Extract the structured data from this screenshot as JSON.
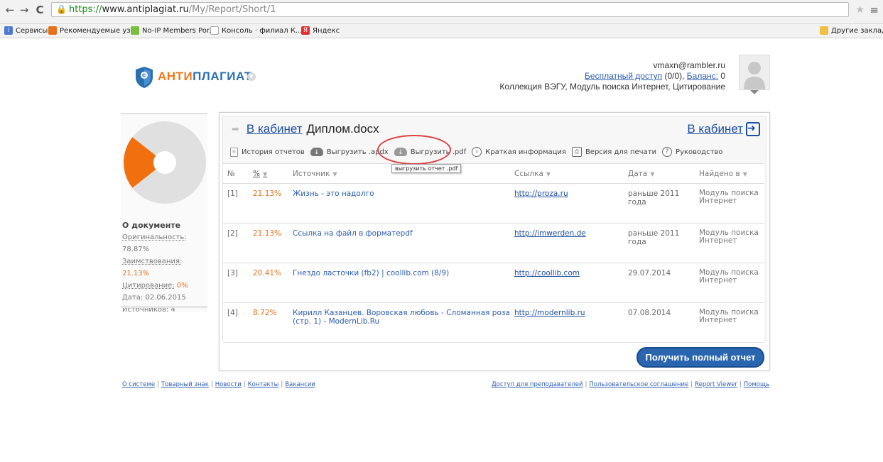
{
  "browser": {
    "url_secure": "https://",
    "url_host": "www.antiplagiat.ru",
    "url_path": "/My/Report/Short/1",
    "bookmarks": [
      {
        "label": "Сервисы",
        "icon": "apps-icon",
        "color": "#4a7bd0"
      },
      {
        "label": "Рекомендуемые уз...",
        "icon": "bookmark-icon",
        "color": "#e8701a"
      },
      {
        "label": "No-IP Members Por...",
        "icon": "bookmark-icon",
        "color": "#7cbf3a"
      },
      {
        "label": "Консоль · филиал К...",
        "icon": "page-icon",
        "color": "#aaaaaa"
      },
      {
        "label": "Яндекс",
        "icon": "yandex-icon",
        "color": "#e03030"
      }
    ],
    "other_bookmarks": "Другие закладки"
  },
  "header": {
    "logo_part1": "АНТИ",
    "logo_part2": "ПЛАГИАТ",
    "email": "vmaxn@rambler.ru",
    "access_link": "Бесплатный доступ",
    "access_count": " (0/0), ",
    "balance_link": "Баланс:",
    "balance_value": " 0",
    "collection": "Коллекция ВЭГУ, Модуль поиска Интернет, Цитирование"
  },
  "sidebar": {
    "title": "О документе",
    "originality_label": "Оригинальность:",
    "originality_value": "78.87%",
    "borrowing_label": "Заимствования:",
    "borrowing_value": "21.13%",
    "citation_label": "Цитирование:",
    "citation_value": "0%",
    "date_label": "Дата:",
    "date_value": "02.06.2015",
    "sources_label": "Источников:",
    "sources_value": "4",
    "pie": {
      "originality": 78.87,
      "borrowing": 21.13,
      "colors": {
        "originality": "#e0e0e0",
        "borrowing": "#f07010"
      }
    }
  },
  "panel": {
    "cabinet_link": "В кабинет",
    "doc_name": "Диплом.docx",
    "cabinet_right": "В кабинет",
    "toolbar": {
      "history": "История отчетов",
      "export_apdx": "Выгрузить .apdx",
      "export_pdf": "Выгрузить .pdf",
      "short_info": "Краткая информация",
      "print_version": "Версия для печати",
      "guide": "Руководство"
    },
    "tooltip": "выгрузить отчет .pdf",
    "columns": {
      "num": "№",
      "pct": "%",
      "source": "Источник",
      "link": "Ссылка",
      "date": "Дата",
      "found_in": "Найдено в"
    },
    "rows": [
      {
        "num": "[1]",
        "pct": "21.13%",
        "source": "Жизнь - это надолго",
        "link": "http://proza.ru",
        "date": "раньше 2011 года",
        "found": "Модуль поиска Интернет"
      },
      {
        "num": "[2]",
        "pct": "21.13%",
        "source": "Ссылка на файл в форматеpdf",
        "link": "http://imwerden.de",
        "date": "раньше 2011 года",
        "found": "Модуль поиска Интернет"
      },
      {
        "num": "[3]",
        "pct": "20.41%",
        "source": "Гнездо ласточки (fb2) | coollib.com (8/9)",
        "link": "http://coollib.com",
        "date": "29.07.2014",
        "found": "Модуль поиска Интернет"
      },
      {
        "num": "[4]",
        "pct": "8.72%",
        "source": "Кирилл Казанцев. Воровская любовь - Сломанная роза (стр. 1) - ModernLib.Ru",
        "link": "http://modernlib.ru",
        "date": "07.08.2014",
        "found": "Модуль поиска Интернет"
      }
    ],
    "full_report_button": "Получить полный отчет"
  },
  "footer": {
    "left": [
      "О системе",
      "Товарный знак",
      "Новости",
      "Контакты",
      "Вакансии"
    ],
    "right": [
      "Доступ для преподавателей",
      "Пользовательское соглашение",
      "Report Viewer",
      "Помощь"
    ]
  }
}
